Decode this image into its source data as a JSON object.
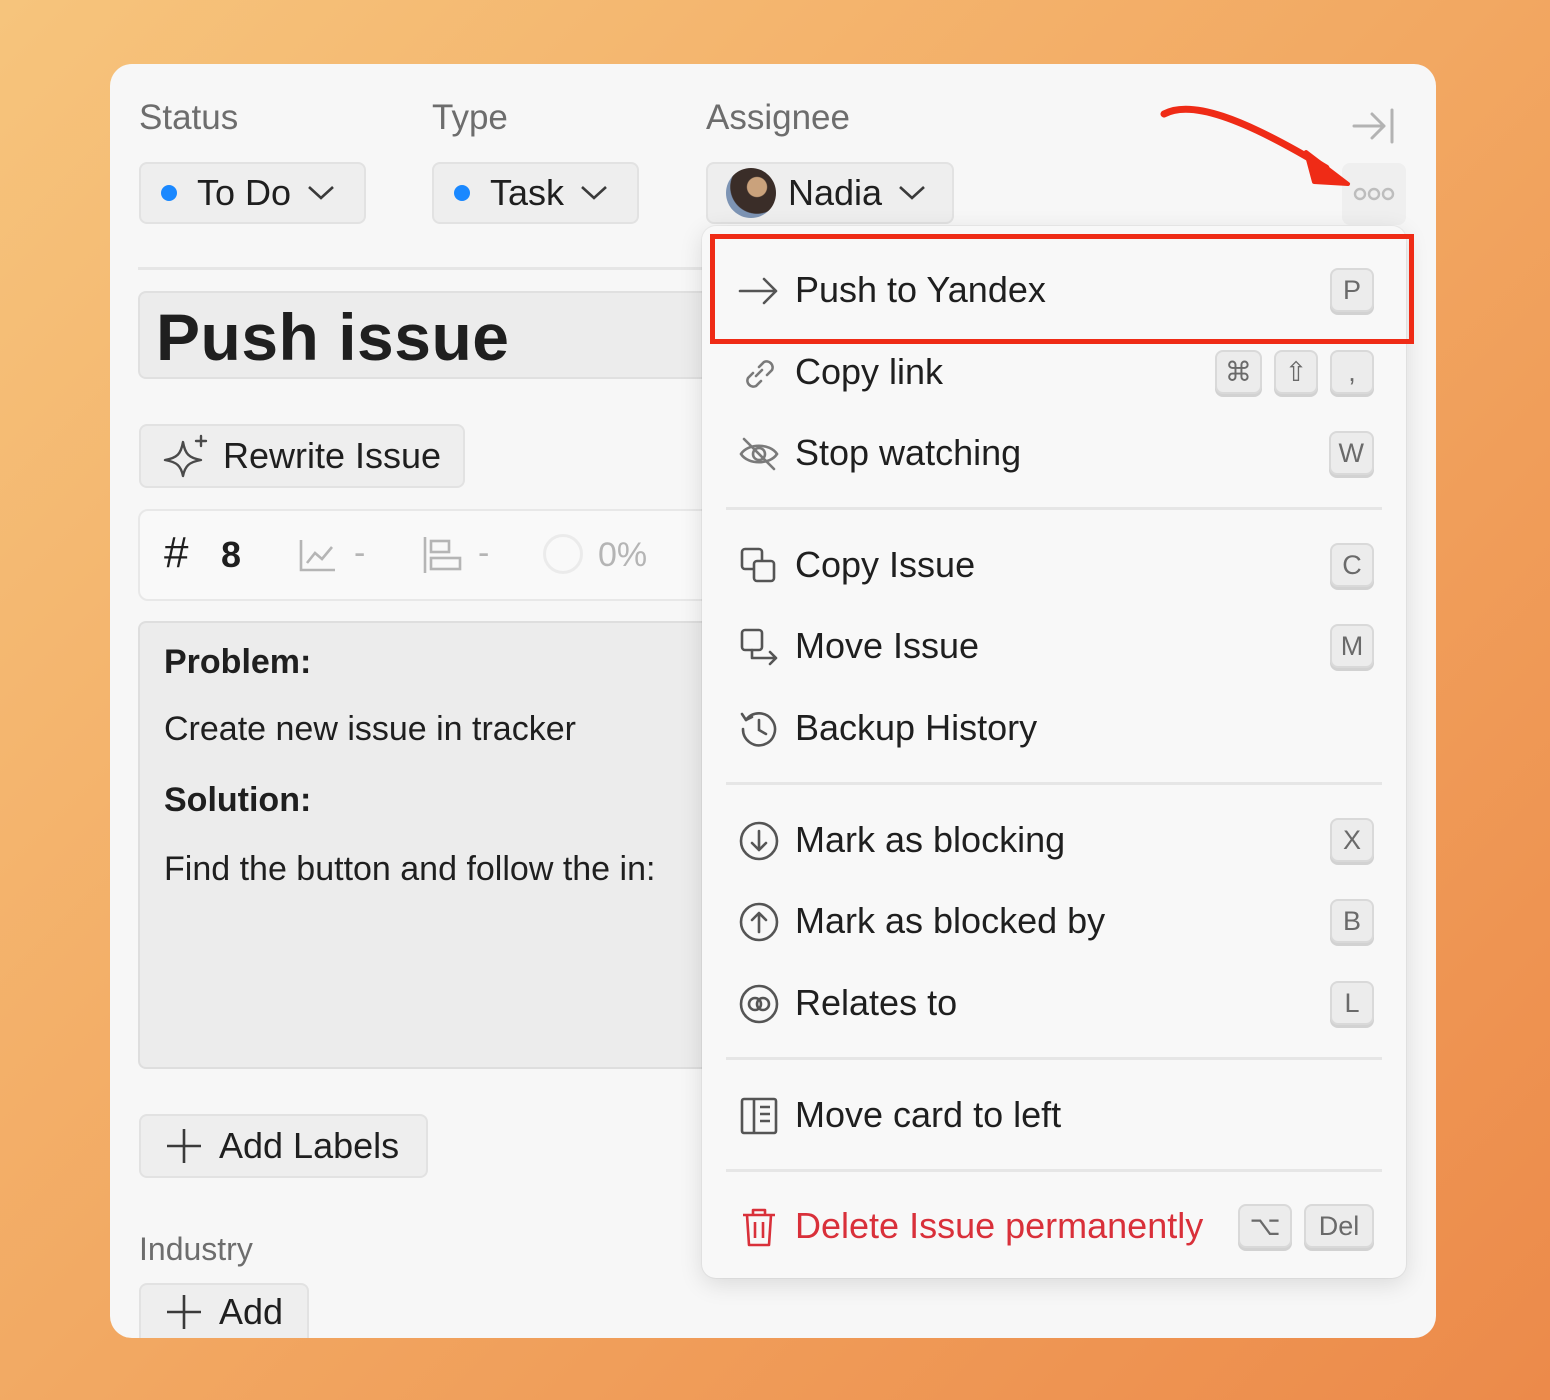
{
  "fields": {
    "status": {
      "label": "Status",
      "value": "To Do",
      "color": "#1a88ff"
    },
    "type": {
      "label": "Type",
      "value": "Task",
      "color": "#1a88ff"
    },
    "assignee": {
      "label": "Assignee",
      "value": "Nadia"
    }
  },
  "issue": {
    "title": "Push issue",
    "rewrite_label": "Rewrite Issue",
    "number_symbol": "#",
    "number": "8",
    "estimate": "-",
    "priority": "-",
    "progress": "0%",
    "description": {
      "problem_heading": "Problem:",
      "problem_text": "Create new issue in tracker",
      "solution_heading": "Solution:",
      "solution_text": "Find the button and follow the in:"
    },
    "add_labels": "Add Labels",
    "industry_label": "Industry",
    "add_label": "Add"
  },
  "menu": {
    "items": [
      {
        "label": "Push to Yandex",
        "icon": "arrow-right-icon",
        "keys": [
          "P"
        ]
      },
      {
        "label": "Copy link",
        "icon": "link-icon",
        "keys": [
          "⌘",
          "⇧",
          ","
        ]
      },
      {
        "label": "Stop watching",
        "icon": "eye-off-icon",
        "keys": [
          "W"
        ]
      },
      {
        "label": "Copy Issue",
        "icon": "copy-icon",
        "keys": [
          "C"
        ]
      },
      {
        "label": "Move Issue",
        "icon": "move-icon",
        "keys": [
          "M"
        ]
      },
      {
        "label": "Backup History",
        "icon": "history-icon",
        "keys": []
      },
      {
        "label": "Mark as blocking",
        "icon": "arrow-down-circle-icon",
        "keys": [
          "X"
        ]
      },
      {
        "label": "Mark as blocked by",
        "icon": "arrow-up-circle-icon",
        "keys": [
          "B"
        ]
      },
      {
        "label": "Relates to",
        "icon": "link-circle-icon",
        "keys": [
          "L"
        ]
      },
      {
        "label": "Move card to left",
        "icon": "panel-left-icon",
        "keys": []
      },
      {
        "label": "Delete Issue permanently",
        "icon": "trash-icon",
        "keys": [
          "⌥",
          "Del"
        ]
      }
    ],
    "danger_color": "#d9303a"
  },
  "annotation": {
    "color": "#ef2b16"
  }
}
